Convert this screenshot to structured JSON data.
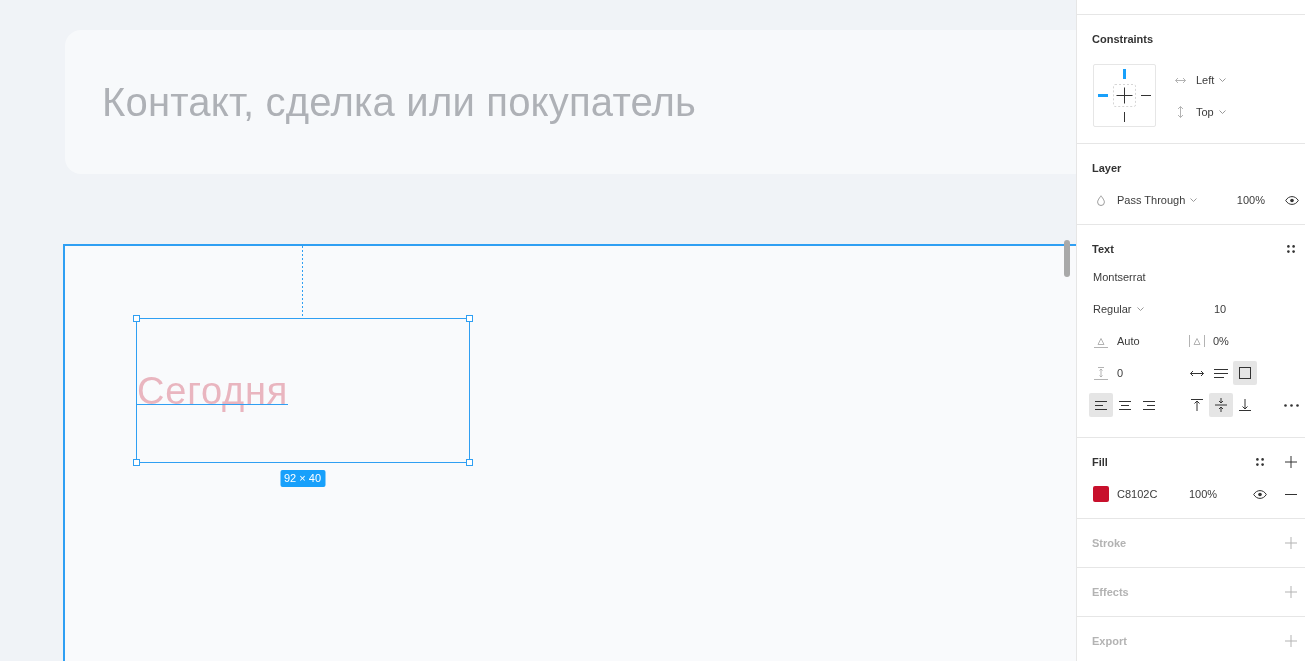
{
  "canvas": {
    "search": {
      "placeholder": "Контакт, сделка или покупатель"
    },
    "frame": {
      "text_layer": "Сегодня",
      "size_badge": "92 × 40"
    }
  },
  "panel": {
    "constraints": {
      "title": "Constraints",
      "pins": [
        {
          "kind": "top",
          "selected": true
        },
        {
          "kind": "left",
          "selected": true
        },
        {
          "kind": "right",
          "selected": false
        },
        {
          "kind": "bottom",
          "selected": false
        }
      ],
      "horizontal": "Left",
      "vertical": "Top"
    },
    "layer": {
      "title": "Layer",
      "blend_mode": "Pass Through",
      "opacity": "100%"
    },
    "text": {
      "title": "Text",
      "font_family": "Montserrat",
      "font_style": "Regular",
      "font_size": "10",
      "line_height": "Auto",
      "letter_spacing": "0%",
      "paragraph_spacing": "0",
      "resizing": [
        {
          "kind": "auto-width",
          "selected": false
        },
        {
          "kind": "auto-height",
          "selected": false
        },
        {
          "kind": "fixed-size",
          "selected": true
        }
      ],
      "align_horizontal": [
        {
          "kind": "left",
          "selected": true
        },
        {
          "kind": "center",
          "selected": false
        },
        {
          "kind": "right",
          "selected": false
        }
      ],
      "align_vertical": [
        {
          "kind": "top",
          "selected": false
        },
        {
          "kind": "middle",
          "selected": true
        },
        {
          "kind": "bottom",
          "selected": false
        }
      ]
    },
    "fill": {
      "title": "Fill",
      "fills": [
        {
          "color": "#c8102c",
          "hex": "C8102C",
          "opacity": "100%"
        }
      ]
    },
    "empty_sections": [
      {
        "title": "Stroke"
      },
      {
        "title": "Effects"
      },
      {
        "title": "Export"
      }
    ]
  }
}
